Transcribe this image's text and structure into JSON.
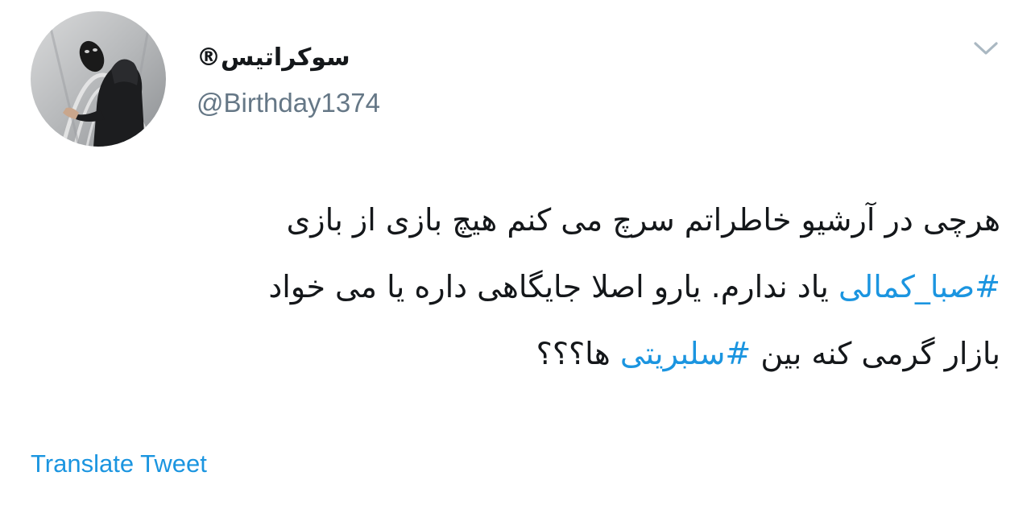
{
  "author": {
    "display_name": "سوکراتیس®",
    "handle": "@Birthday1374",
    "avatar_icon": "masked-person-avatar"
  },
  "menu": {
    "icon": "chevron-down-icon"
  },
  "tweet": {
    "line1": {
      "text": "هرچی در آرشیو خاطراتم سرچ می کنم هیچ بازی از بازی"
    },
    "line2": {
      "hashtag": "#صبا_کمالی",
      "text": " یاد ندارم. یارو اصلا جایگاهی داره یا می خواد"
    },
    "line3": {
      "text_before": "بازار گرمی کنه بین ",
      "hashtag": "#سلبریتی",
      "text_after": " ها؟؟؟"
    }
  },
  "actions": {
    "translate_label": "Translate Tweet"
  },
  "colors": {
    "link": "#1b95e0",
    "secondary_text": "#657786",
    "primary_text": "#14171a",
    "background": "#ffffff"
  }
}
